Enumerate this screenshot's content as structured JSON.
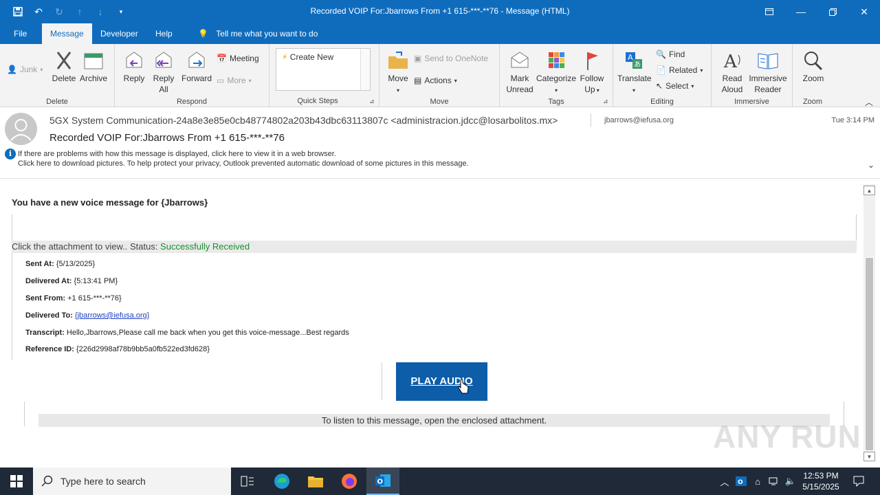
{
  "window": {
    "title": "Recorded VOIP For:Jbarrows From +1 615-***-**76  -  Message (HTML)"
  },
  "tabs": [
    "File",
    "Message",
    "Developer",
    "Help",
    "Tell me what you want to do"
  ],
  "ribbon": {
    "delete_group": {
      "label": "Delete",
      "junk": "Junk",
      "delete": "Delete",
      "archive": "Archive"
    },
    "respond_group": {
      "label": "Respond",
      "reply": "Reply",
      "reply_all_1": "Reply",
      "reply_all_2": "All",
      "forward": "Forward",
      "meeting": "Meeting",
      "more": "More"
    },
    "quicksteps_group": {
      "label": "Quick Steps",
      "create_new": "Create New"
    },
    "move_group": {
      "label": "Move",
      "move": "Move",
      "send_onenote": "Send to OneNote",
      "actions": "Actions"
    },
    "tags_group": {
      "label": "Tags",
      "mark_unread_1": "Mark",
      "mark_unread_2": "Unread",
      "categorize": "Categorize",
      "follow_up_1": "Follow",
      "follow_up_2": "Up"
    },
    "editing_group": {
      "label": "Editing",
      "translate": "Translate",
      "find": "Find",
      "related": "Related",
      "select": "Select"
    },
    "immersive_group": {
      "label": "Immersive",
      "read_aloud_1": "Read",
      "read_aloud_2": "Aloud",
      "immersive_reader_1": "Immersive",
      "immersive_reader_2": "Reader"
    },
    "zoom_group": {
      "label": "Zoom",
      "zoom": "Zoom"
    }
  },
  "message": {
    "from": "5GX System Communication-24a8e3e85e0cb48774802a203b43dbc63113807c <administracion.jdcc@losarbolitos.mx>",
    "to": "jbarrows@iefusa.org",
    "date": "Tue 3:14 PM",
    "subject": "Recorded VOIP For:Jbarrows From +1 615-***-**76",
    "info_line_1": "If there are problems with how this message is displayed, click here to view it in a web browser.",
    "info_line_2": "Click here to download pictures. To help protect your privacy, Outlook prevented automatic download of some pictures in this message."
  },
  "body": {
    "headline": "You have a new voice message for {Jbarrows}",
    "status_prefix": "Click the attachment to view.. Status: ",
    "status_value": "Successfully Received",
    "fields": [
      {
        "label": "Sent At:",
        "value": "{5/13/2025}"
      },
      {
        "label": "Delivered At:",
        "value": "{5:13:41 PM}"
      },
      {
        "label": "Sent From:",
        "value": "+1 615-***-**76}"
      },
      {
        "label": "Delivered To:",
        "value": "{jbarrows@iefusa.org}"
      },
      {
        "label": "Transcript:",
        "value": "Hello,Jbarrows,Please call me back when you get this voice-message...Best regards"
      },
      {
        "label": "Reference ID:",
        "value": "{226d2998af78b9bb5a0fb522ed3fd628}"
      }
    ],
    "play_button": "PLAY AUDIO",
    "listen_note": "To listen to this message, open the enclosed attachment.",
    "watermark": "ANY RUN"
  },
  "taskbar": {
    "search_placeholder": "Type here to search",
    "time": "12:53 PM",
    "date": "5/15/2025"
  },
  "colors": {
    "brand_blue": "#0f6cbd",
    "play_button": "#0d5da8",
    "status_green": "#1a8f2c"
  }
}
